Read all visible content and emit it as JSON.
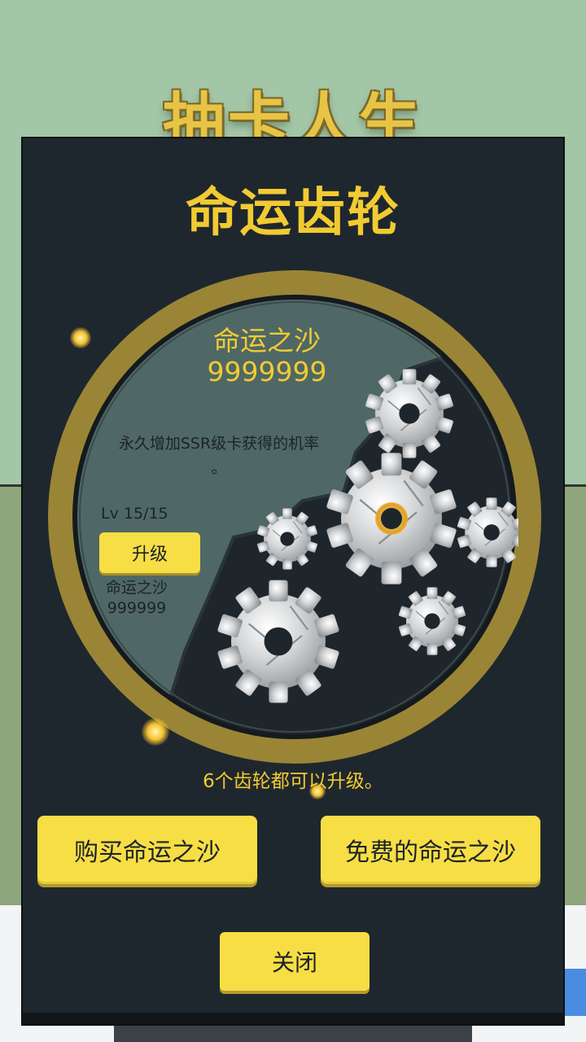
{
  "game_title": "抽卡人生",
  "modal": {
    "title": "命运齿轮",
    "gear_info": {
      "currency_name": "命运之沙",
      "currency_amount": "9999999",
      "description_line1": "永久增加SSR级卡获得的机率",
      "description_line2": "。",
      "level": "Lv 15/15",
      "upgrade_label": "升级",
      "cost_name": "命运之沙",
      "cost_amount": "999999"
    },
    "note": "6个齿轮都可以升级。",
    "buy_label": "购买命运之沙",
    "free_label": "免费的命运之沙",
    "close_label": "关闭"
  },
  "colors": {
    "accent_yellow": "#f2cb32",
    "button_yellow": "#f8de45",
    "panel_dark": "#1f272e",
    "wheel_slate": "#4f6866",
    "background_green": "#a3c6a6"
  },
  "icons": [
    "gear-icon",
    "sparkle-icon"
  ]
}
